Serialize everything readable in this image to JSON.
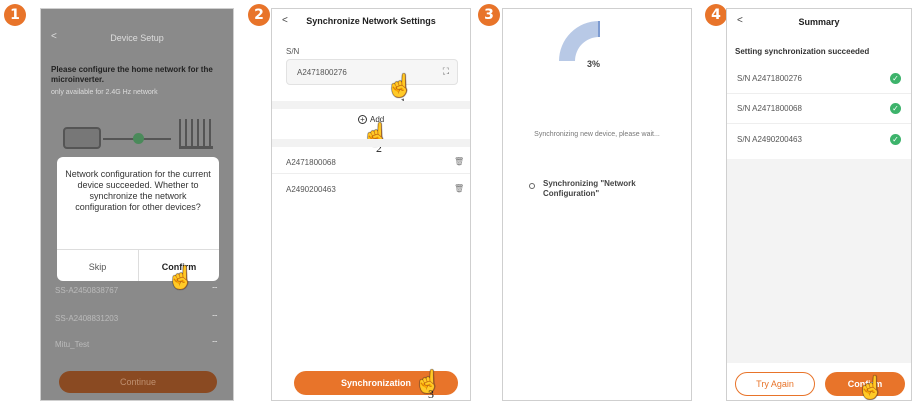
{
  "steps": [
    "1",
    "2",
    "3",
    "4"
  ],
  "screen1": {
    "back": "<",
    "title": "Device Setup",
    "instruction": "Please configure the home network for the microinverter.",
    "note": "only available for 2.4G Hz network",
    "dialog_text": "Network configuration for the current device succeeded. Whether to synchronize the network configuration for other devices?",
    "skip": "Skip",
    "confirm": "Confirm",
    "networks": [
      "SS-A2450838767",
      "SS-A2408831203",
      "Mitu_Test"
    ],
    "continue": "Continue"
  },
  "screen2": {
    "back": "<",
    "title": "Synchronize Network Settings",
    "sn_label": "S/N",
    "sn_value": "A2471800276",
    "add": "Add",
    "devices": [
      "A2471800068",
      "A2490200463"
    ],
    "sync_button": "Synchronization",
    "marker1": "1",
    "marker2": "2",
    "marker3": "3"
  },
  "screen3": {
    "progress": 3,
    "progress_text": "3%",
    "status": "Synchronizing new device, please wait...",
    "task": "Synchronizing \"Network Configuration\""
  },
  "screen4": {
    "back": "<",
    "title": "Summary",
    "result": "Setting synchronization succeeded",
    "items": [
      "S/N A2471800276",
      "S/N A2471800068",
      "S/N A2490200463"
    ],
    "try_again": "Try Again",
    "confirm": "Confirm"
  },
  "colors": {
    "accent": "#e8742a",
    "success": "#3db36b",
    "progress": "#b8c9e6"
  }
}
